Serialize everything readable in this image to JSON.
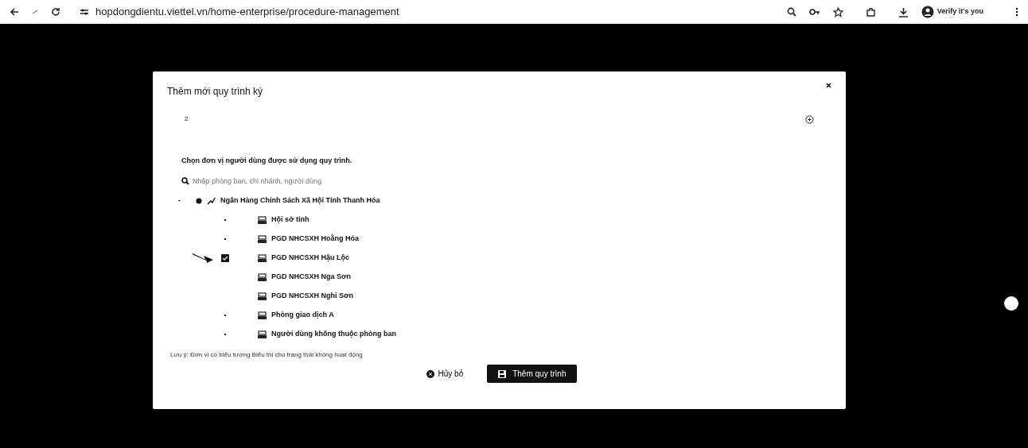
{
  "browser": {
    "url": "hopdongdientu.viettel.vn/home-enterprise/procedure-management",
    "profile_label": "Verify it's you"
  },
  "modal": {
    "title": "Thêm mới quy trình ký",
    "step_number": "2",
    "instruction": "Chọn đơn vị người dùng được sử dụng quy trình.",
    "search": {
      "placeholder": "Nhập phòng ban, chi nhánh, người dùng"
    },
    "tree": [
      {
        "toggle": "-",
        "label": "Ngân Hàng Chính Sách Xã Hội Tỉnh Thanh Hóa",
        "selected": true,
        "children": [
          {
            "label": "Hội sở tỉnh",
            "has_children": true,
            "checked": false,
            "pointed": false
          },
          {
            "label": "PGD NHCSXH Hoằng Hóa",
            "has_children": true,
            "checked": false,
            "pointed": false
          },
          {
            "label": "PGD NHCSXH Hậu Lộc",
            "has_children": false,
            "checked": true,
            "pointed": true
          },
          {
            "label": "PGD NHCSXH Nga Sơn",
            "has_children": false,
            "checked": false,
            "pointed": false
          },
          {
            "label": "PGD NHCSXH Nghi Sơn",
            "has_children": false,
            "checked": false,
            "pointed": false
          },
          {
            "label": "Phòng giao dịch A",
            "has_children": true,
            "checked": false,
            "pointed": false
          },
          {
            "label": "Người dùng không thuộc phòng ban",
            "has_children": true,
            "checked": false,
            "pointed": false
          }
        ]
      }
    ],
    "note": "Lưu ý: Đơn vị có biểu tượng  Biểu thị cho trạng thái không hoạt động",
    "buttons": [
      {
        "label": "Hủy bỏ",
        "kind": "cancel"
      },
      {
        "label": "Thêm quy trình",
        "kind": "primary"
      }
    ]
  }
}
